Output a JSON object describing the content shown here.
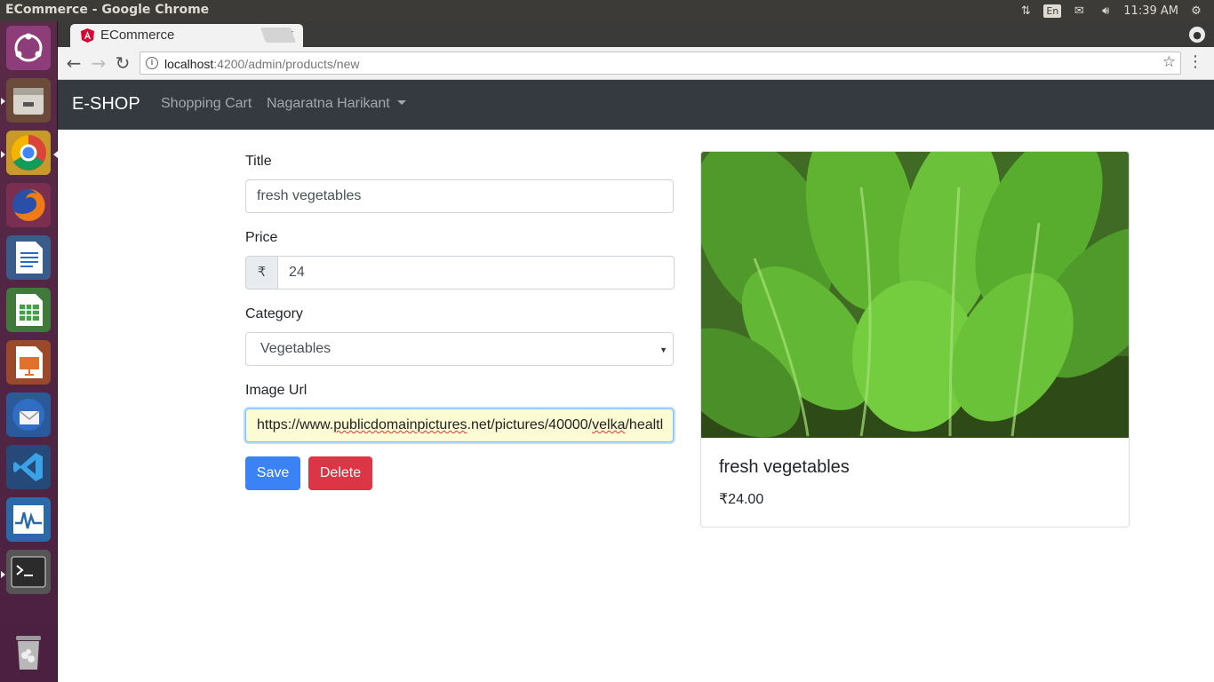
{
  "os": {
    "window_title": "ECommerce - Google Chrome",
    "keyboard_layout": "En",
    "clock": "11:39 AM"
  },
  "browser": {
    "tab_title": "ECommerce",
    "tab_close": "×",
    "url_host": "localhost",
    "url_path": ":4200/admin/products/new"
  },
  "app": {
    "brand": "E-SHOP",
    "nav": {
      "shopping_cart": "Shopping Cart",
      "user": "Nagaratna Harikant"
    }
  },
  "form": {
    "title_label": "Title",
    "title_value": "fresh vegetables",
    "price_label": "Price",
    "currency_symbol": "₹",
    "price_value": "24",
    "category_label": "Category",
    "category_value": "Vegetables",
    "image_label": "Image Url",
    "image_url_prefix": "https://www.",
    "image_url_word1": "publicdomainpictures",
    "image_url_mid": ".net/pictures/40000/",
    "image_url_word2": "velka",
    "image_url_word3": "/healtl",
    "save_label": "Save",
    "delete_label": "Delete"
  },
  "preview": {
    "title": "fresh vegetables",
    "price": "₹24.00"
  },
  "colors": {
    "navbar": "#343a40",
    "primary": "#3b82f6",
    "danger": "#dc3545",
    "launcher": "#5a2a48"
  },
  "icons": [
    "ubuntu-icon",
    "files-icon",
    "chrome-icon",
    "firefox-icon",
    "writer-icon",
    "calc-icon",
    "impress-icon",
    "thunderbird-icon",
    "vscode-icon",
    "system-monitor-icon",
    "terminal-icon",
    "trash-icon"
  ]
}
